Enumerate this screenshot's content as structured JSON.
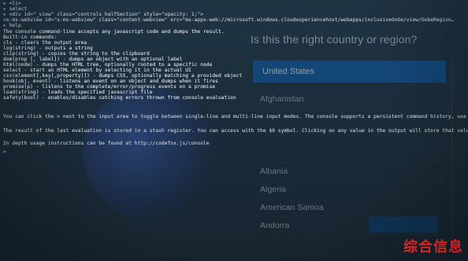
{
  "background_page": {
    "title": "Is this the right country or region?",
    "selected_item": "United States",
    "items": [
      "Afghanistan",
      "",
      "",
      "",
      "Albania",
      "Algeria",
      "American Samoa",
      "Andorra"
    ],
    "colors": {
      "accent": "#0b5aa8",
      "button": "#0b3f74"
    }
  },
  "console": {
    "dom_lines": [
      {
        "indent": "▸",
        "text": "<li>"
      },
      {
        "indent": "▸",
        "text": "select"
      },
      {
        "indent": "▸",
        "text": "<div id=\"_view\" class=\"controls halfSection\" style=\"opacity: 1;\">"
      },
      {
        "indent": "",
        "text": "  <x-ms-webview id=\"x-ms-webview\" class=\"content-webview\" src=\"ms-appx-web://microsoft.windows.cloudexperiencehost/webapps/inclusiveOobe/view/OobeRegion…"
      },
      {
        "indent": "▸",
        "text": "help"
      }
    ],
    "help_lines": [
      "The console command-line accepts any javascript code and dumps the result.",
      "Built-in commands:",
      "cls - clears the output area",
      "log(string) - outputs a string",
      "clip(string) - copies the string to the clipboard",
      "dom(prop [, label]) - dumps an object with an optional label",
      "html(node) - dumps the HTML tree, optionally rooted to a specific node",
      "select - start an HTML element by selecting it in the actual UI",
      "css(element[,key[,property]]) - dumps CSS, optionally matching a provided object",
      "hook(obj, event) - listens an event on an object and dumps when it fires",
      "promise(p) - listens to the complete/error/progress events on a promise",
      "load(string) - loads the specified javascript file",
      "safety(bool) - enables/disables catching errors thrown from console evaluation"
    ],
    "para_1": "You can click the > next to the input area to toggle between single-line and multi-line input modes. The console supports a persistent command history, use the arrow key",
    "para_2": "The result of the last evaluation is stored in a stash register. You can access with the $0 symbol. Clicking on any value in the output will store that value into a numbered re",
    "para_3": "In depth usage instructions can be found at http://codefox.js/console",
    "prompt": ">"
  },
  "watermark": {
    "text": "综合信息",
    "color": "#ff2e2e"
  }
}
